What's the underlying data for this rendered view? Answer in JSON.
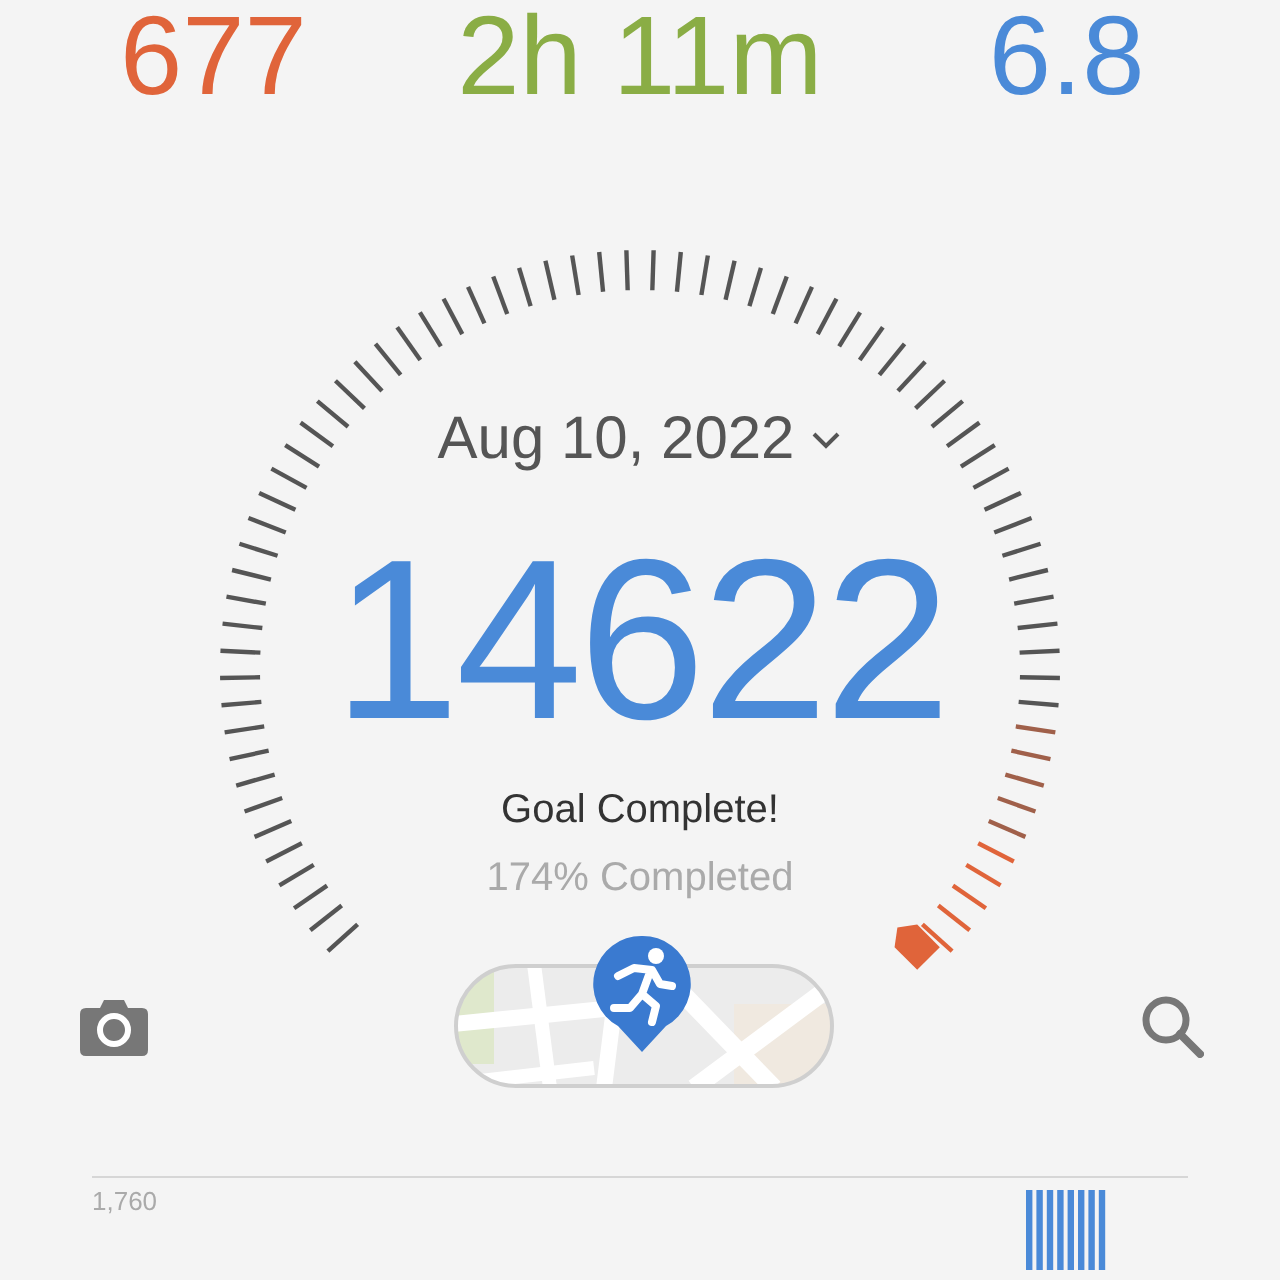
{
  "stats": [
    {
      "value": "677",
      "color": "#e0643a"
    },
    {
      "value": "2h 11m",
      "color": "#8aad45"
    },
    {
      "value": "6.8",
      "color": "#4a8ad8"
    }
  ],
  "date_selector": {
    "label": "Aug 10, 2022"
  },
  "steps": {
    "value": "14622",
    "status": "Goal Complete!",
    "progress": "174% Completed"
  },
  "chart": {
    "max_label": "1,760"
  }
}
